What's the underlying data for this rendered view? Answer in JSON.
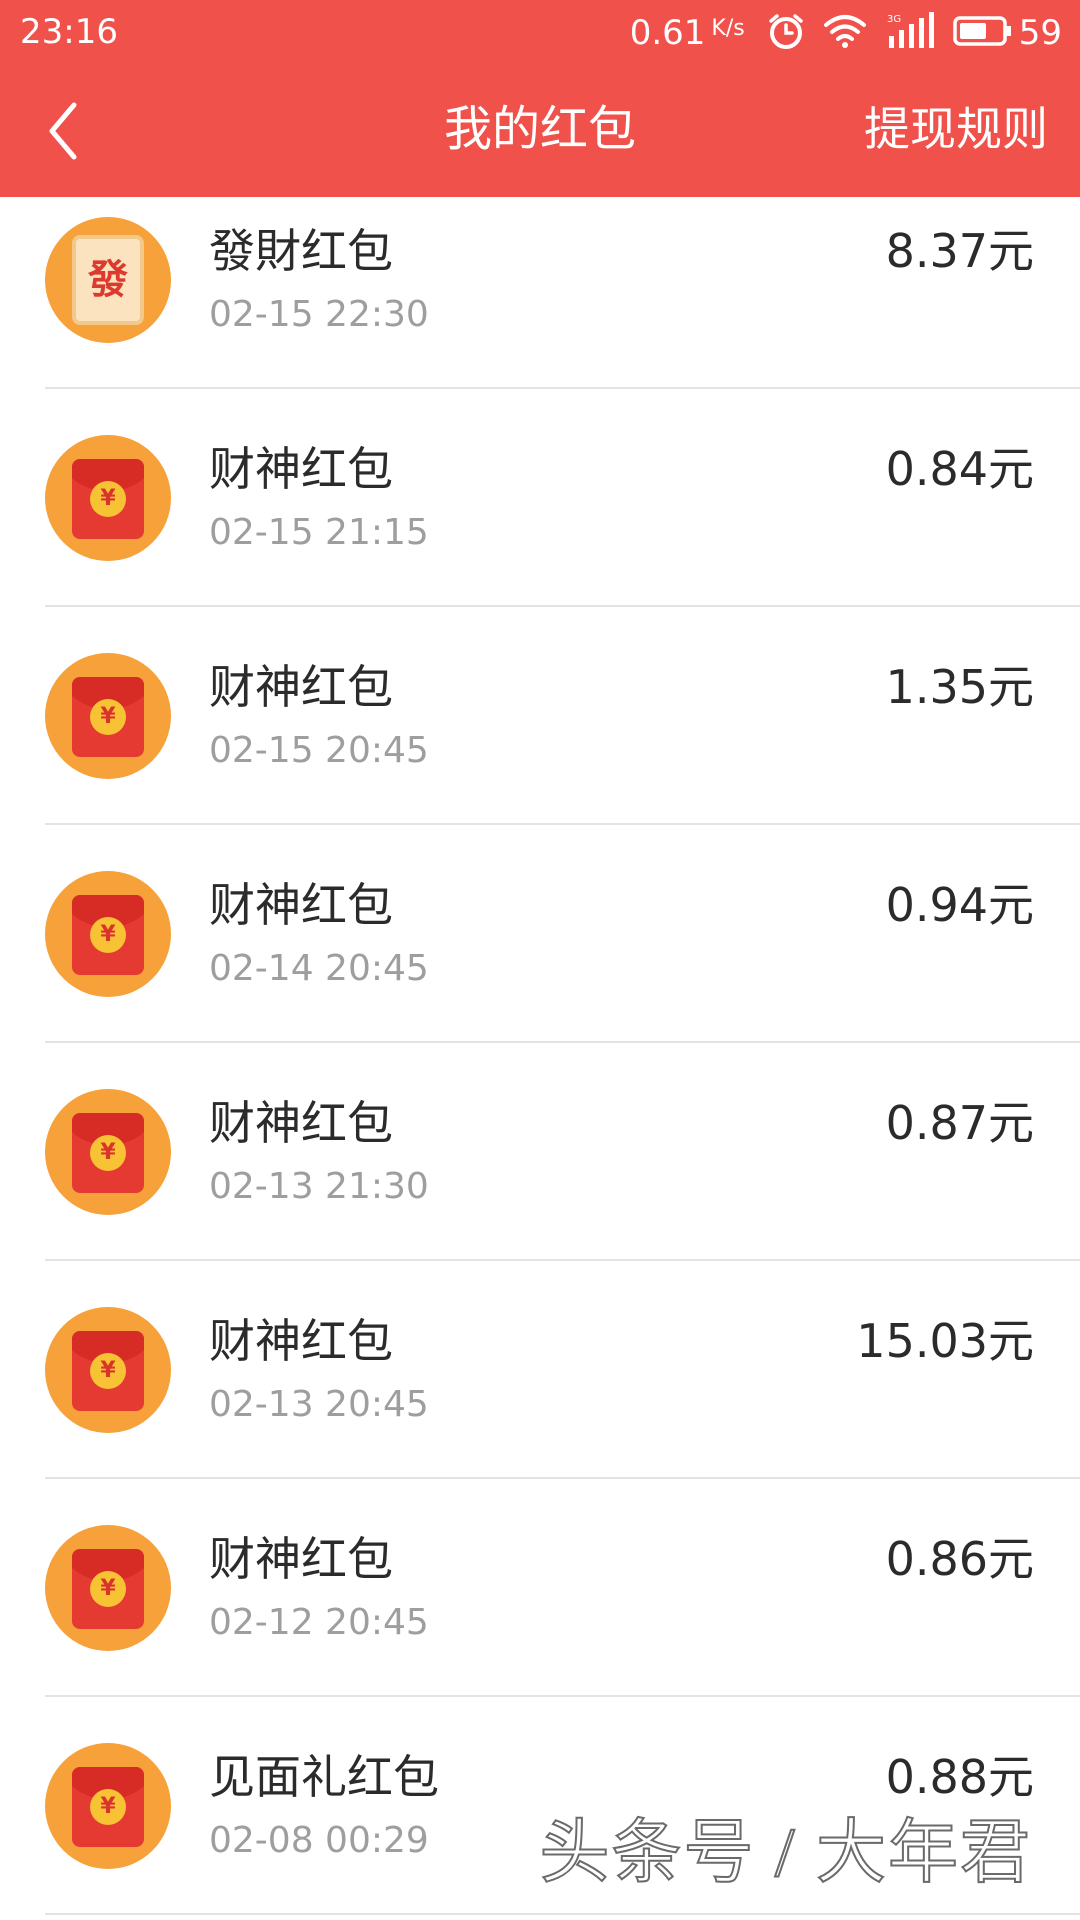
{
  "status_bar": {
    "time": "23:16",
    "net_speed": "0.61",
    "net_unit": "K/s",
    "network_type": "3G",
    "battery_level": "59",
    "icons": [
      "alarm-icon",
      "wifi-icon",
      "signal-icon",
      "battery-icon"
    ]
  },
  "nav": {
    "back_icon": "chevron-left-icon",
    "title": "我的红包",
    "rules_label": "提现规则"
  },
  "colors": {
    "header_bg": "#f0514b",
    "avatar_bg": "#f6a13a",
    "envelope_red": "#e43a32",
    "coin_gold": "#f7c334",
    "text_primary": "#2b2b2b",
    "text_secondary": "#9e9e9e"
  },
  "items": [
    {
      "icon": "fa-card-icon",
      "icon_text": "發",
      "name": "發財红包",
      "time": "02-15 22:30",
      "amount": "8.37元"
    },
    {
      "icon": "red-envelope-icon",
      "icon_text": "¥",
      "name": "财神红包",
      "time": "02-15 21:15",
      "amount": "0.84元"
    },
    {
      "icon": "red-envelope-icon",
      "icon_text": "¥",
      "name": "财神红包",
      "time": "02-15 20:45",
      "amount": "1.35元"
    },
    {
      "icon": "red-envelope-icon",
      "icon_text": "¥",
      "name": "财神红包",
      "time": "02-14 20:45",
      "amount": "0.94元"
    },
    {
      "icon": "red-envelope-icon",
      "icon_text": "¥",
      "name": "财神红包",
      "time": "02-13 21:30",
      "amount": "0.87元"
    },
    {
      "icon": "red-envelope-icon",
      "icon_text": "¥",
      "name": "财神红包",
      "time": "02-13 20:45",
      "amount": "15.03元"
    },
    {
      "icon": "red-envelope-icon",
      "icon_text": "¥",
      "name": "财神红包",
      "time": "02-12 20:45",
      "amount": "0.86元"
    },
    {
      "icon": "red-envelope-icon",
      "icon_text": "¥",
      "name": "见面礼红包",
      "time": "02-08 00:29",
      "amount": "0.88元"
    }
  ],
  "watermark": "头条号 / 大年君"
}
